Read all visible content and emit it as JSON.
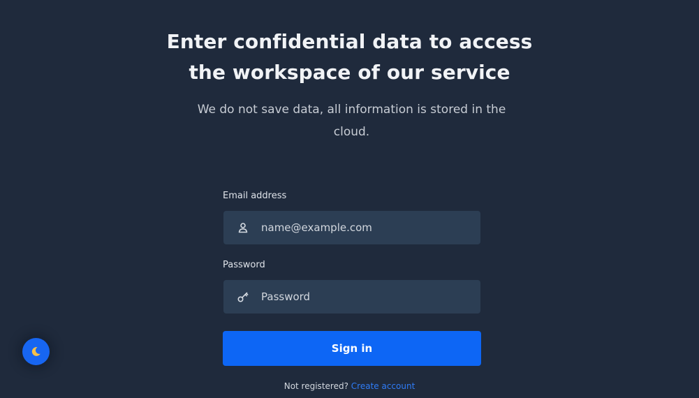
{
  "header": {
    "title_line1": "Enter confidential data to access",
    "title_line2": "the workspace of our service",
    "subtitle": "We do not save data, all information is stored in the cloud."
  },
  "form": {
    "email": {
      "label": "Email address",
      "placeholder": "name@example.com",
      "value": "",
      "icon": "user-icon"
    },
    "password": {
      "label": "Password",
      "placeholder": "Password",
      "value": "",
      "icon": "key-icon"
    },
    "submit_label": "Sign in"
  },
  "footer": {
    "prompt": "Not registered?",
    "link_label": "Create account"
  },
  "theme_toggle": {
    "icon": "moon-icon"
  },
  "colors": {
    "background": "#1f2a3c",
    "input_background": "#2c3e54",
    "accent": "#0d66f5",
    "link": "#2f7cf6",
    "moon": "#f5c04a"
  }
}
